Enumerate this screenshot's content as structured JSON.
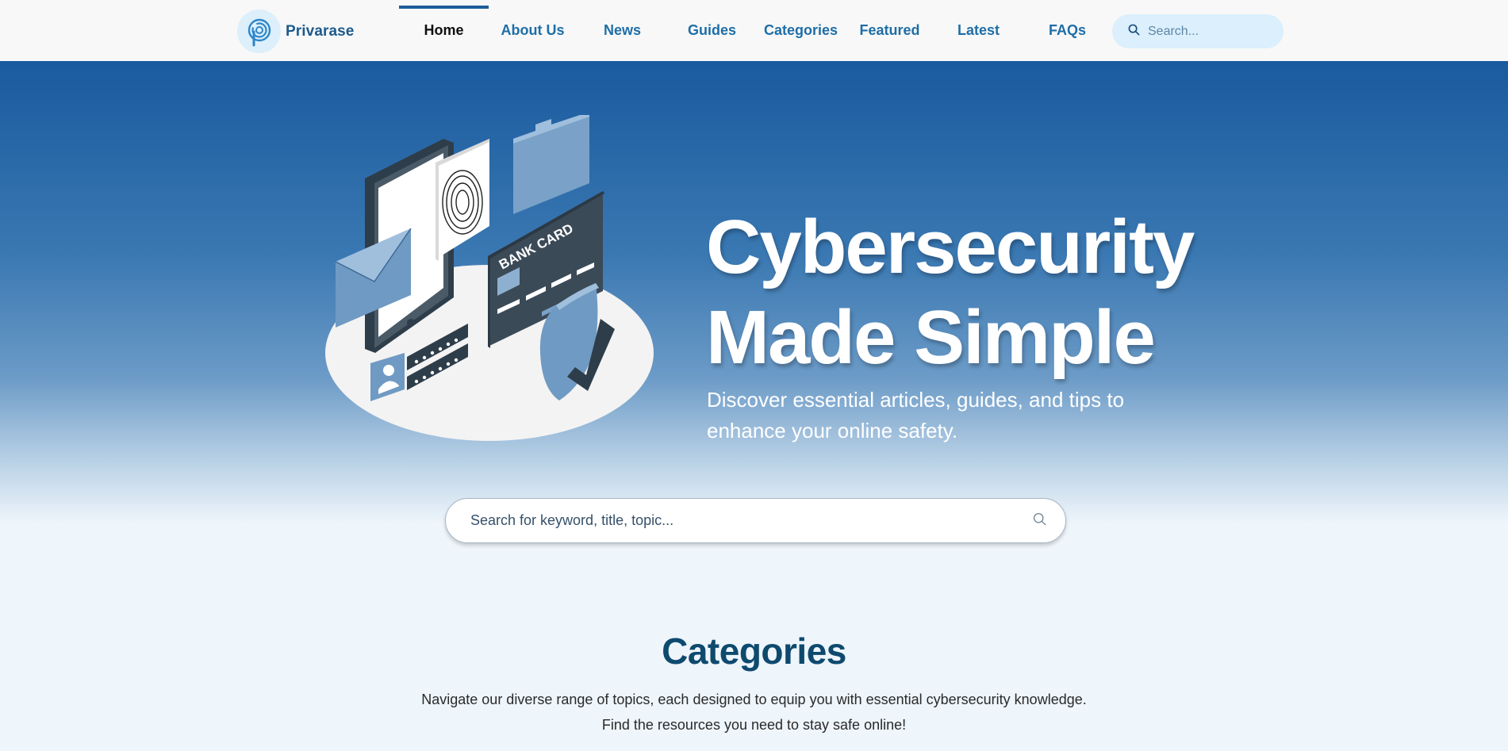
{
  "brand": {
    "name": "Privarase"
  },
  "nav": {
    "items": [
      {
        "label": "Home",
        "active": true
      },
      {
        "label": "About Us"
      },
      {
        "label": "News"
      },
      {
        "label": "Guides"
      },
      {
        "label": "Categories"
      },
      {
        "label": "Featured"
      },
      {
        "label": "Latest"
      },
      {
        "label": "FAQs"
      }
    ]
  },
  "header_search": {
    "placeholder": "Search..."
  },
  "hero": {
    "title_line1": "Cybersecurity",
    "title_line2": "Made Simple",
    "subtitle": "Discover essential articles, guides, and tips to enhance your online safety.",
    "illustration": {
      "card_text": "BANK CARD"
    }
  },
  "main_search": {
    "placeholder": "Search for keyword, title, topic..."
  },
  "categories": {
    "title": "Categories",
    "line1": "Navigate our diverse range of topics, each designed to equip you with essential cybersecurity knowledge.",
    "line2": "Find the resources you need to stay safe online!"
  },
  "colors": {
    "brand": "#1d5a8c",
    "nav_link": "#1e6ea7",
    "active_indicator": "#1e5d99",
    "hero_top": "#1a5a9e",
    "page_bg": "#eef5fb",
    "section_title": "#0e4a6e"
  }
}
